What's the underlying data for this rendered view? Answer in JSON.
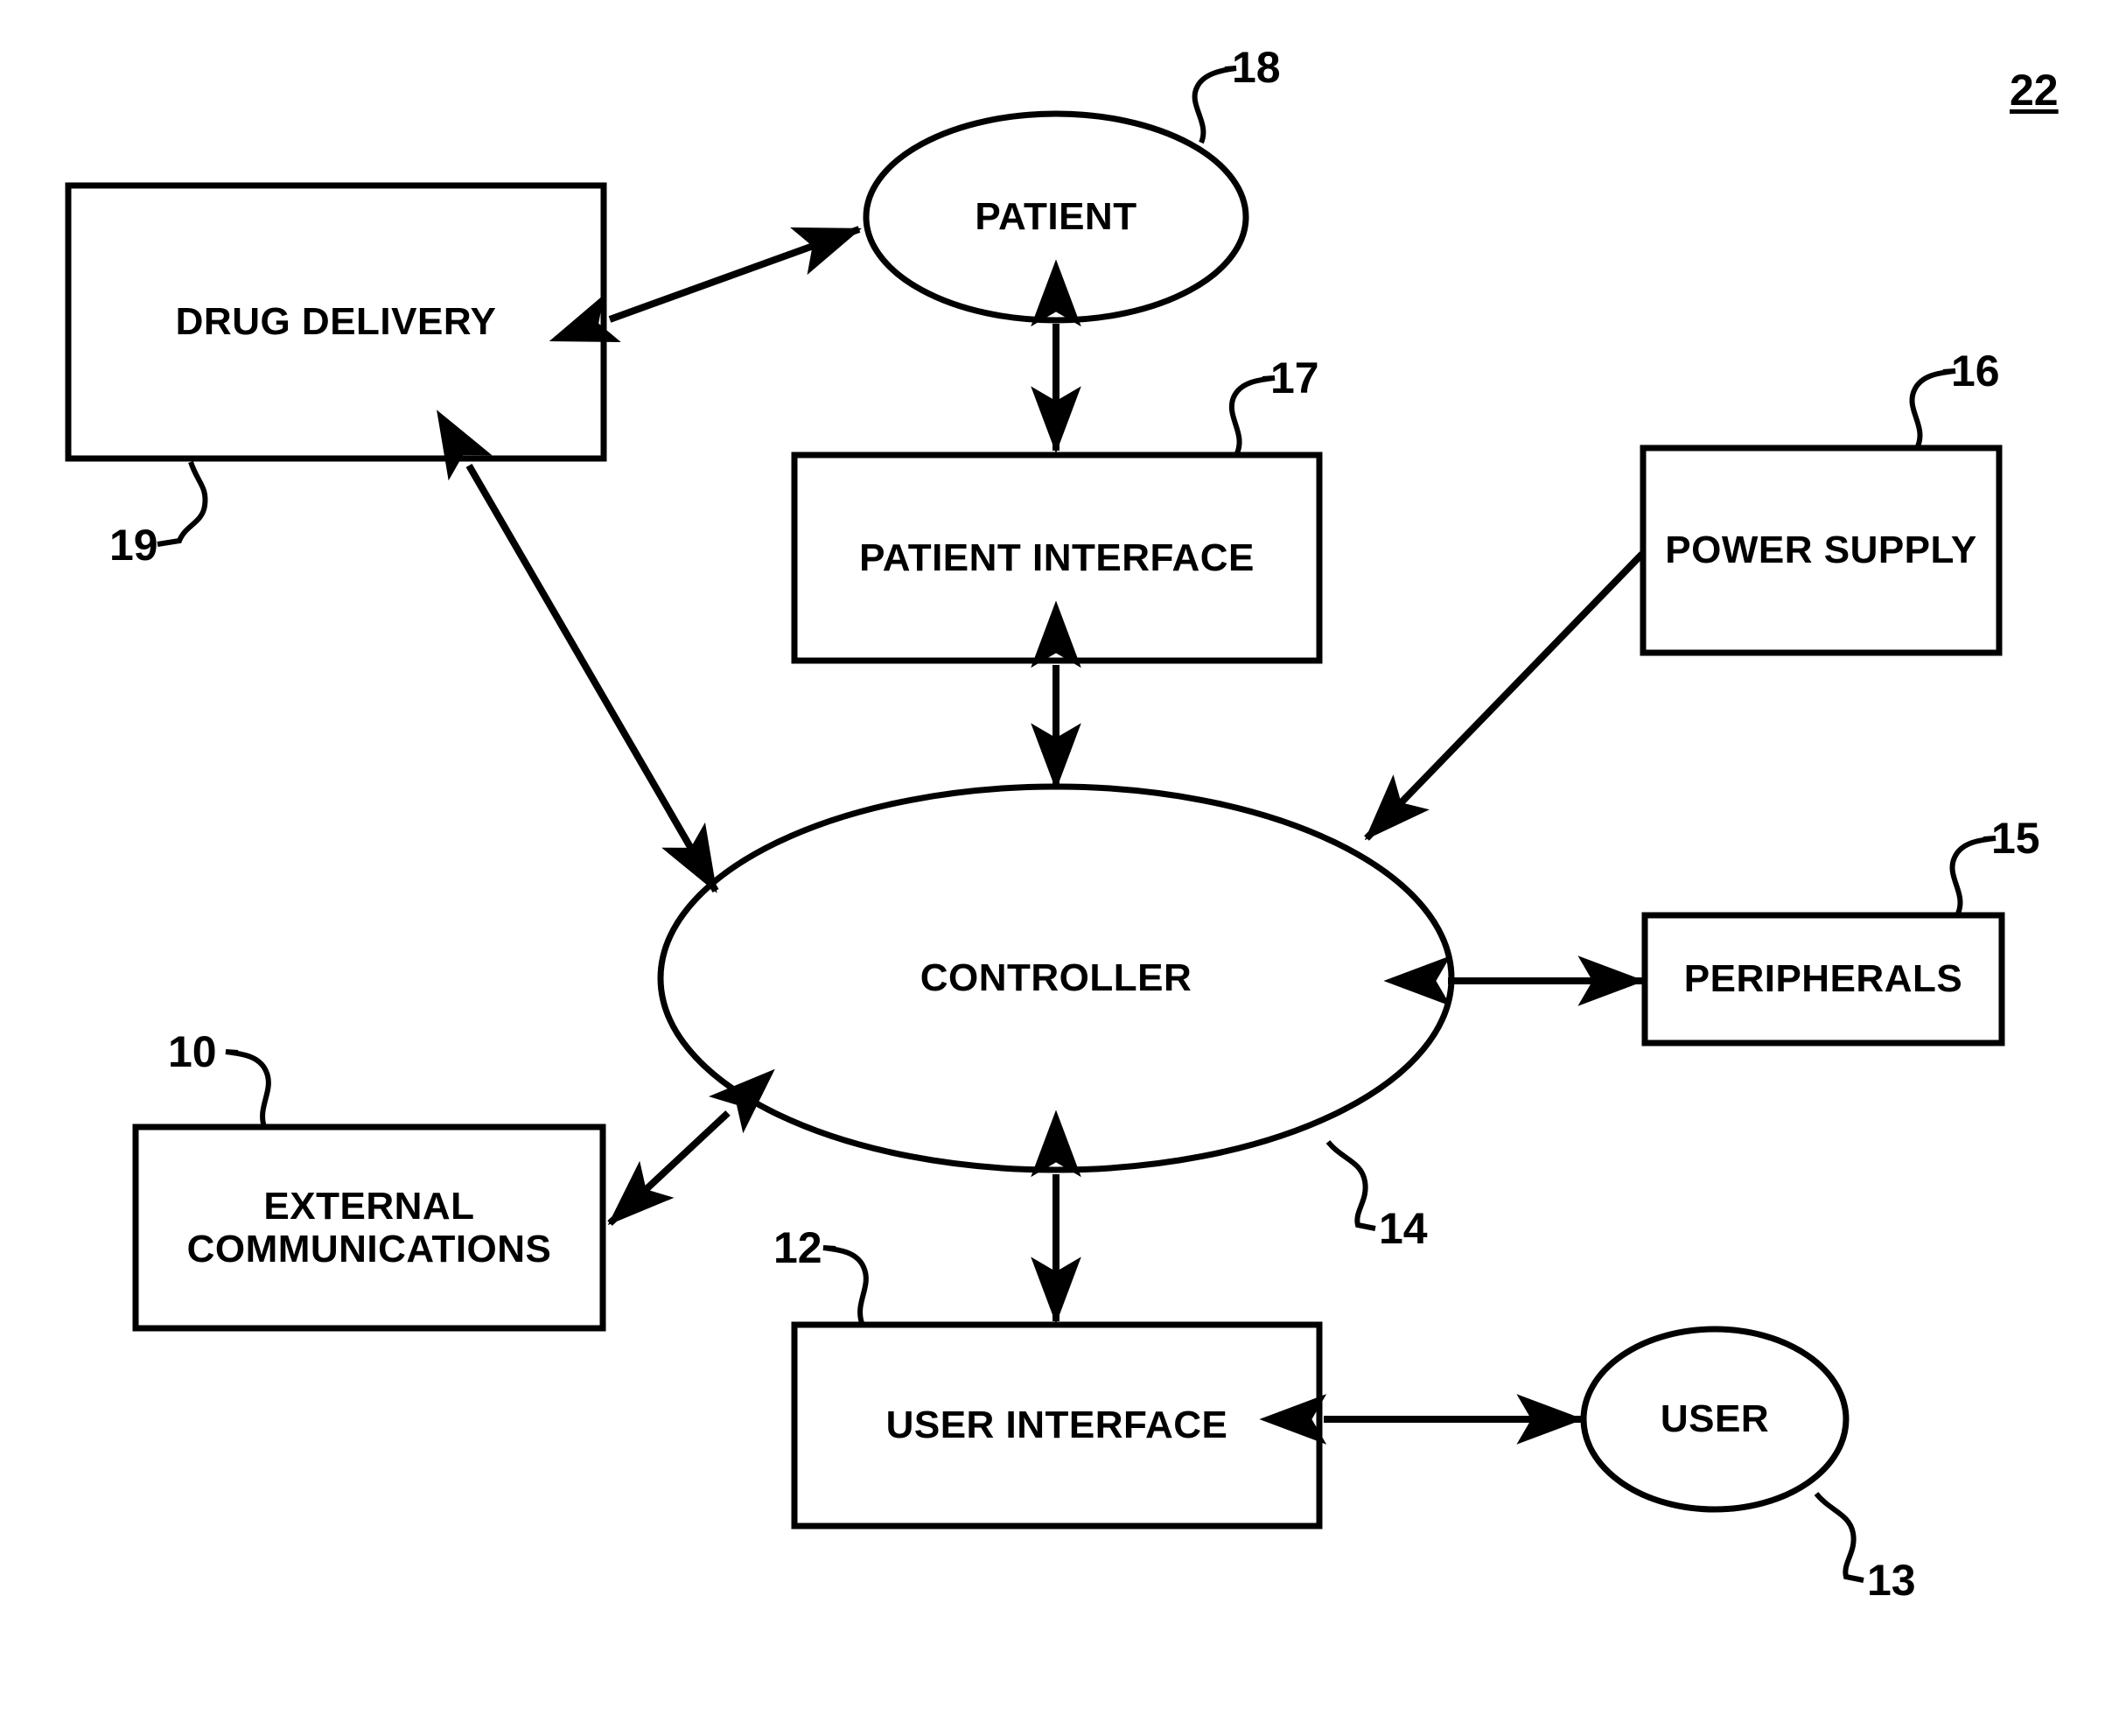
{
  "figure": {
    "figure_number": "22",
    "nodes": [
      {
        "id": "drug_delivery",
        "label": "DRUG DELIVERY",
        "shape": "rect",
        "ref": "19"
      },
      {
        "id": "patient",
        "label": "PATIENT",
        "shape": "ellipse",
        "ref": "18"
      },
      {
        "id": "patient_iface",
        "label": "PATIENT INTERFACE",
        "shape": "rect",
        "ref": "17"
      },
      {
        "id": "power_supply",
        "label": "POWER SUPPLY",
        "shape": "rect",
        "ref": "16"
      },
      {
        "id": "controller",
        "label": "CONTROLLER",
        "shape": "ellipse",
        "ref": "14"
      },
      {
        "id": "peripherals",
        "label": "PERIPHERALS",
        "shape": "rect",
        "ref": "15"
      },
      {
        "id": "external_comms",
        "label": "EXTERNAL\nCOMMUNICATIONS",
        "shape": "rect",
        "ref": "10"
      },
      {
        "id": "user_iface",
        "label": "USER INTERFACE",
        "shape": "rect",
        "ref": "12"
      },
      {
        "id": "user",
        "label": "USER",
        "shape": "ellipse",
        "ref": "13"
      }
    ],
    "connections": [
      {
        "from": "drug_delivery",
        "to": "patient",
        "arrows": "both"
      },
      {
        "from": "patient",
        "to": "patient_iface",
        "arrows": "both"
      },
      {
        "from": "patient_iface",
        "to": "controller",
        "arrows": "both"
      },
      {
        "from": "drug_delivery",
        "to": "controller",
        "arrows": "both"
      },
      {
        "from": "power_supply",
        "to": "controller",
        "arrows": "to"
      },
      {
        "from": "controller",
        "to": "peripherals",
        "arrows": "both"
      },
      {
        "from": "controller",
        "to": "external_comms",
        "arrows": "both"
      },
      {
        "from": "controller",
        "to": "user_iface",
        "arrows": "both"
      },
      {
        "from": "user_iface",
        "to": "user",
        "arrows": "both"
      }
    ],
    "reference_numerals": [
      "10",
      "12",
      "13",
      "14",
      "15",
      "16",
      "17",
      "18",
      "19",
      "22"
    ],
    "colors": {
      "stroke": "#000000",
      "fill": "#ffffff",
      "text": "#000000"
    }
  }
}
